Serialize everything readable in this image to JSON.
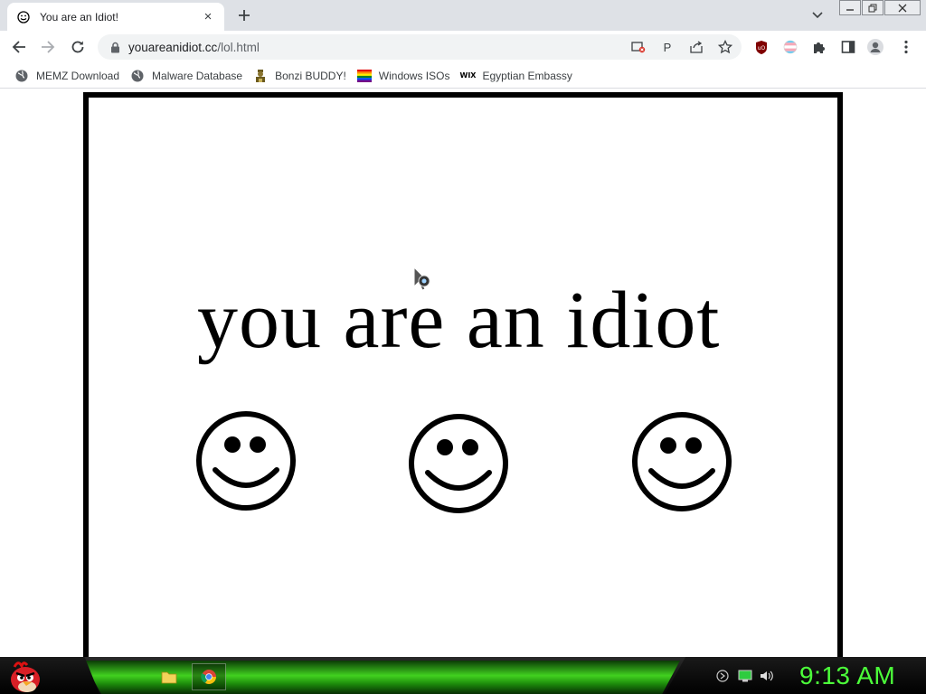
{
  "tab": {
    "title": "You are an Idiot!",
    "close_symbol": "×"
  },
  "toolbar": {
    "url_host": "youareanidiot.cc",
    "url_path": "/lol.html",
    "pin_letter": "P"
  },
  "bookmarks": [
    {
      "label": "MEMZ Download",
      "icon": "globe-icon"
    },
    {
      "label": "Malware Database",
      "icon": "globe-icon"
    },
    {
      "label": "Bonzi BUDDY!",
      "icon": "bonzi-icon"
    },
    {
      "label": "Windows ISOs",
      "icon": "rainbow-flag-icon"
    },
    {
      "label": "Egyptian Embassy",
      "icon": "wix-icon"
    }
  ],
  "wix_mark": "WIX",
  "page": {
    "headline": "you are an idiot"
  },
  "taskbar": {
    "clock": "9:13 AM"
  },
  "colors": {
    "clock": "#4cff3a",
    "taskbar_green": "#41d11f",
    "tabstrip": "#dee1e6"
  }
}
